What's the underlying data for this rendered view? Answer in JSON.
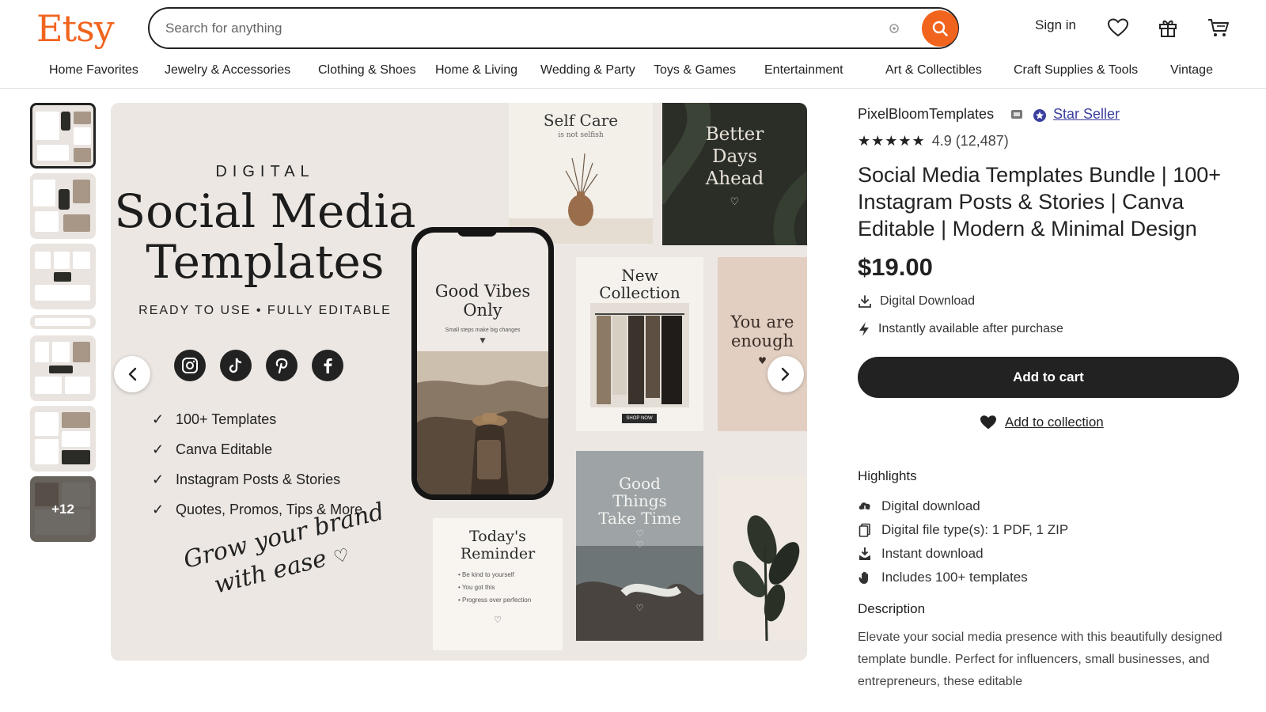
{
  "brand": {
    "logo": "Etsy",
    "accent": "#f1641e"
  },
  "search": {
    "placeholder": "Search for anything"
  },
  "header": {
    "sign_in": "Sign in"
  },
  "nav": [
    "Home Favorites",
    "Jewelry & Accessories",
    "Clothing & Shoes",
    "Home & Living",
    "Wedding & Party",
    "Toys & Games",
    "Entertainment",
    "Art & Collectibles",
    "Craft Supplies & Tools",
    "Vintage"
  ],
  "gallery": {
    "more_count": "+12"
  },
  "hero": {
    "digital": "DIGITAL",
    "title_line1": "Social Media",
    "title_line2": "Templates",
    "ready": "READY TO USE • FULLY EDITABLE",
    "features": [
      "100+ Templates",
      "Canva Editable",
      "Instagram Posts & Stories",
      "Quotes, Promos, Tips & More"
    ],
    "script_line1": "Grow your brand",
    "script_line2": "with ease",
    "cards": {
      "self_care": "Self Care",
      "self_care_sub": "is not selfish",
      "better_days": "Better Days Ahead",
      "good_vibes": "Good Vibes Only",
      "good_vibes_sub": "Small steps make big changes",
      "new_collection": "New Collection",
      "shop_now": "SHOP NOW",
      "you_are": "You are enough",
      "good_things": "Good Things Take Time",
      "reminder": "Today's Reminder",
      "reminder_items": [
        "Be kind to yourself",
        "You got this",
        "Progress over perfection"
      ]
    }
  },
  "shop": {
    "name": "PixelBloomTemplates",
    "badge": "Star Seller",
    "stars": "★★★★★",
    "rating": "4.9 (12,487)"
  },
  "product": {
    "title": "Social Media Templates Bundle | 100+ Instagram Posts & Stories | Canva Editable | Modern & Minimal Design",
    "price": "$19.00",
    "digital_download": "Digital Download",
    "instant": "Instantly available after purchase",
    "add_to_cart": "Add to cart",
    "add_to_collection": "Add to collection"
  },
  "highlights": {
    "heading": "Highlights",
    "items": [
      "Digital download",
      "Digital file type(s): 1 PDF, 1 ZIP",
      "Instant download",
      "Includes 100+ templates"
    ]
  },
  "description": {
    "heading": "Description",
    "text": "Elevate your social media presence with this beautifully designed template bundle. Perfect for influencers, small businesses, and entrepreneurs, these editable"
  }
}
